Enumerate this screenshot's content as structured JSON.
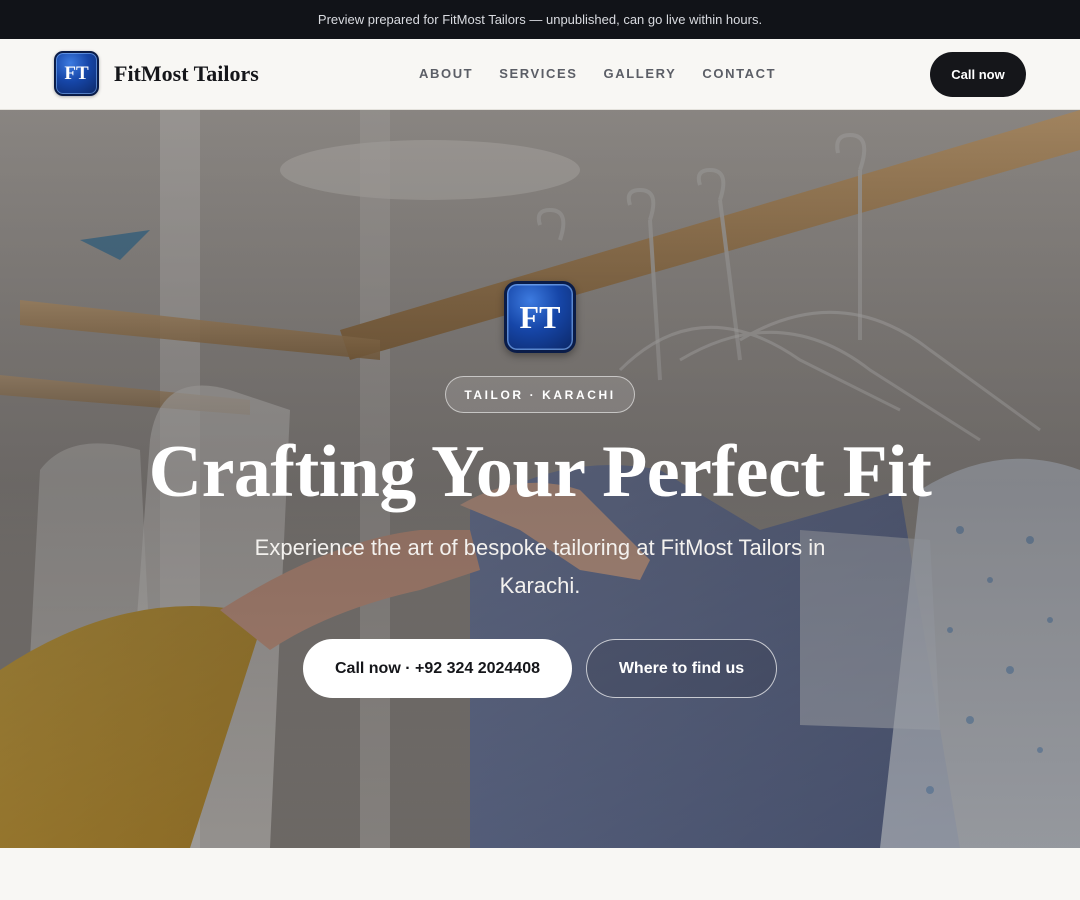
{
  "preview_bar": {
    "text": "Preview prepared for FitMost Tailors — unpublished, can go live within hours."
  },
  "header": {
    "logo_text": "FT",
    "brand_name": "FitMost Tailors",
    "nav": [
      "ABOUT",
      "SERVICES",
      "GALLERY",
      "CONTACT"
    ],
    "cta_label": "Call now"
  },
  "hero": {
    "logo_text": "FT",
    "tag": "TAILOR · KARACHI",
    "title": "Crafting Your Perfect Fit",
    "subtitle": "Experience the art of bespoke tailoring at FitMost Tailors in Karachi.",
    "primary_button": "Call now · +92 324 2024408",
    "secondary_button": "Where to find us"
  },
  "colors": {
    "dark": "#15161a",
    "logo_blue": "#1646a8",
    "page_bg": "#f8f7f4"
  }
}
